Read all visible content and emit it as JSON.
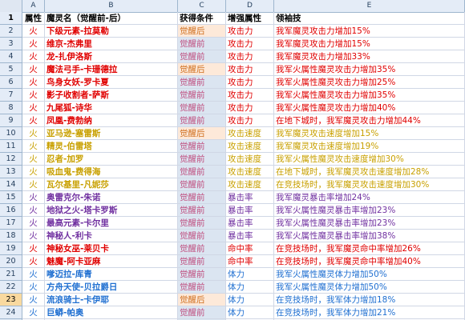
{
  "colors": {
    "red": "#e00000",
    "gold": "#c8a000",
    "purple": "#7030a0",
    "blue": "#1f6fd1",
    "rn_selected": "#f9d99f",
    "cond_orange_bg": "#fde9d9",
    "cond_blue_bg": "#dbe5f1"
  },
  "columns": [
    "A",
    "B",
    "C",
    "D",
    "E"
  ],
  "header_row": {
    "num": "1",
    "attr": "属性",
    "name": "魔灵名（觉醒前-后）",
    "cond": "获得条件",
    "enh": "增强属性",
    "skill": "领袖技"
  },
  "rows": [
    {
      "num": "2",
      "attr": "火",
      "name": "下级元素-拉莫勒",
      "cond": "觉醒后",
      "enh": "攻击力",
      "skill": "我军魔灵攻击力增加15%",
      "color": "red",
      "cbg": "orange"
    },
    {
      "num": "3",
      "attr": "火",
      "name": "维京-杰弗里",
      "cond": "觉醒前",
      "enh": "攻击力",
      "skill": "我军魔灵攻击力增加15%",
      "color": "red",
      "cbg": "blue"
    },
    {
      "num": "4",
      "attr": "火",
      "name": "龙-扎伊洛斯",
      "cond": "觉醒前",
      "enh": "攻击力",
      "skill": "我军魔灵攻击力增加33%",
      "color": "red",
      "cbg": "blue"
    },
    {
      "num": "5",
      "attr": "火",
      "name": "魔法弓手-卡珊德拉",
      "cond": "觉醒后",
      "enh": "攻击力",
      "skill": "我军火属性魔灵攻击力增加35%",
      "color": "red",
      "cbg": "orange"
    },
    {
      "num": "6",
      "attr": "火",
      "name": "鸟身女妖-罗卡夏",
      "cond": "觉醒前",
      "enh": "攻击力",
      "skill": "我军火属性魔灵攻击力增加25%",
      "color": "red",
      "cbg": "blue"
    },
    {
      "num": "7",
      "attr": "火",
      "name": "影子收割者-萨斯",
      "cond": "觉醒前",
      "enh": "攻击力",
      "skill": "我军火属性魔灵攻击力增加35%",
      "color": "red",
      "cbg": "blue"
    },
    {
      "num": "8",
      "attr": "火",
      "name": "九尾狐-诗华",
      "cond": "觉醒前",
      "enh": "攻击力",
      "skill": "我军火属性魔灵攻击力增加40%",
      "color": "red",
      "cbg": "blue"
    },
    {
      "num": "9",
      "attr": "火",
      "name": "凤凰-费勃纳",
      "cond": "觉醒前",
      "enh": "攻击力",
      "skill": "在地下城时，我军魔灵攻击力增加44%",
      "color": "red",
      "cbg": "blue"
    },
    {
      "num": "10",
      "attr": "火",
      "name": "亚马逊-塞雷斯",
      "cond": "觉醒后",
      "enh": "攻击速度",
      "skill": "我军魔灵攻击速度增加15%",
      "color": "gold",
      "cbg": "orange"
    },
    {
      "num": "11",
      "attr": "火",
      "name": "精灵-伯雷塔",
      "cond": "觉醒前",
      "enh": "攻击速度",
      "skill": "我军魔灵攻击速度增加19%",
      "color": "gold",
      "cbg": "blue"
    },
    {
      "num": "12",
      "attr": "火",
      "name": "忍者-加罗",
      "cond": "觉醒前",
      "enh": "攻击速度",
      "skill": "我军火属性魔灵攻击速度增加30%",
      "color": "gold",
      "cbg": "blue"
    },
    {
      "num": "13",
      "attr": "火",
      "name": "吸血鬼-费得海",
      "cond": "觉醒前",
      "enh": "攻击速度",
      "skill": "在地下城时，我军魔灵攻击速度增加28%",
      "color": "gold",
      "cbg": "blue"
    },
    {
      "num": "14",
      "attr": "火",
      "name": "瓦尔基里-凡妮莎",
      "cond": "觉醒前",
      "enh": "攻击速度",
      "skill": "在竞技场时，我军魔灵攻击速度增加30%",
      "color": "gold",
      "cbg": "blue"
    },
    {
      "num": "15",
      "attr": "火",
      "name": "奥雷克尔-朱诺",
      "cond": "觉醒前",
      "enh": "暴击率",
      "skill": "我军魔灵暴击率增加24%",
      "color": "purple",
      "cbg": "blue"
    },
    {
      "num": "16",
      "attr": "火",
      "name": "地狱之火-塔卡罗斯",
      "cond": "觉醒前",
      "enh": "暴击率",
      "skill": "我军火属性魔灵暴击率增加23%",
      "color": "purple",
      "cbg": "blue"
    },
    {
      "num": "17",
      "attr": "火",
      "name": "最高元素-卡尔里",
      "cond": "觉醒前",
      "enh": "暴击率",
      "skill": "我军火属性魔灵暴击率增加23%",
      "color": "purple",
      "cbg": "blue"
    },
    {
      "num": "18",
      "attr": "火",
      "name": "神秘人-利卡",
      "cond": "觉醒前",
      "enh": "暴击率",
      "skill": "我军火属性魔灵暴击率增加38%",
      "color": "purple",
      "cbg": "blue"
    },
    {
      "num": "19",
      "attr": "火",
      "name": "神秘女巫-莱贝卡",
      "cond": "觉醒前",
      "enh": "命中率",
      "skill": "在竞技场时，我军魔灵命中率增加26%",
      "color": "red",
      "cbg": "blue"
    },
    {
      "num": "20",
      "attr": "火",
      "name": "魅魔-阿卡亚麻",
      "cond": "觉醒前",
      "enh": "命中率",
      "skill": "在竞技场时，我军魔灵命中率增加40%",
      "color": "red",
      "cbg": "blue"
    },
    {
      "num": "21",
      "attr": "火",
      "name": "嗲迈拉-库青",
      "cond": "觉醒前",
      "enh": "体力",
      "skill": "我军火属性魔灵体力增加50%",
      "color": "blue",
      "cbg": "blue"
    },
    {
      "num": "22",
      "attr": "火",
      "name": "方舟天使-贝拉爵日",
      "cond": "觉醒前",
      "enh": "体力",
      "skill": "我军火属性魔灵体力增加50%",
      "color": "blue",
      "cbg": "blue"
    },
    {
      "num": "23",
      "attr": "火",
      "name": "流浪骑士-卡伊耶",
      "cond": "觉醒后",
      "enh": "体力",
      "skill": "在竞技场时，我军体力增加18%",
      "color": "blue",
      "cbg": "orange",
      "selected": true
    },
    {
      "num": "24",
      "attr": "火",
      "name": "巨蟒-帕奥",
      "cond": "觉醒前",
      "enh": "体力",
      "skill": "在竞技场时，我军体力增加21%",
      "color": "blue",
      "cbg": "blue"
    },
    {
      "num": "25",
      "attr": "火",
      "name": "比尔曼-神报",
      "cond": "觉醒前",
      "enh": "防御力",
      "skill": "在竞技场时，我军防御力增加33%",
      "color": "red",
      "cbg": "blue"
    }
  ]
}
